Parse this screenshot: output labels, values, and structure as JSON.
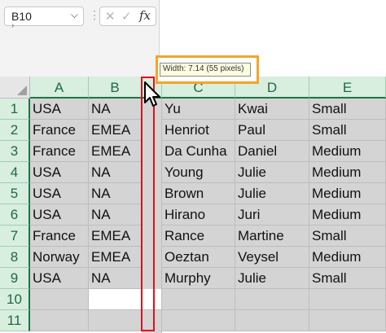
{
  "name_box": {
    "value": "B10"
  },
  "formula_bar": {
    "cancel_icon": "close-icon",
    "enter_icon": "check-icon",
    "fx_label": "fx"
  },
  "tooltip": {
    "text": "Width: 7.14 (55 pixels)"
  },
  "columns": [
    "A",
    "B",
    "C",
    "D",
    "E"
  ],
  "rows": [
    "1",
    "2",
    "3",
    "4",
    "5",
    "6",
    "7",
    "8",
    "9",
    "10",
    "11"
  ],
  "data": [
    [
      "USA",
      "NA",
      "Yu",
      "Kwai",
      "Small"
    ],
    [
      "France",
      "EMEA",
      "Henriot",
      "Paul",
      "Small"
    ],
    [
      "France",
      "EMEA",
      "Da Cunha",
      "Daniel",
      "Medium"
    ],
    [
      "USA",
      "NA",
      "Young",
      "Julie",
      "Medium"
    ],
    [
      "USA",
      "NA",
      "Brown",
      "Julie",
      "Medium"
    ],
    [
      "USA",
      "NA",
      "Hirano",
      "Juri",
      "Medium"
    ],
    [
      "France",
      "EMEA",
      "Rance",
      "Martine",
      "Small"
    ],
    [
      "Norway",
      "EMEA",
      "Oeztan",
      "Veysel",
      "Medium"
    ],
    [
      "USA",
      "NA",
      "Murphy",
      "Julie",
      "Small"
    ],
    [
      "",
      "",
      "",
      "",
      ""
    ],
    [
      "",
      "",
      "",
      "",
      ""
    ]
  ],
  "colors": {
    "accent": "#217346",
    "selection": "#d4d4d4",
    "highlight_orange": "#f4a52a",
    "highlight_red": "#e0101a"
  }
}
